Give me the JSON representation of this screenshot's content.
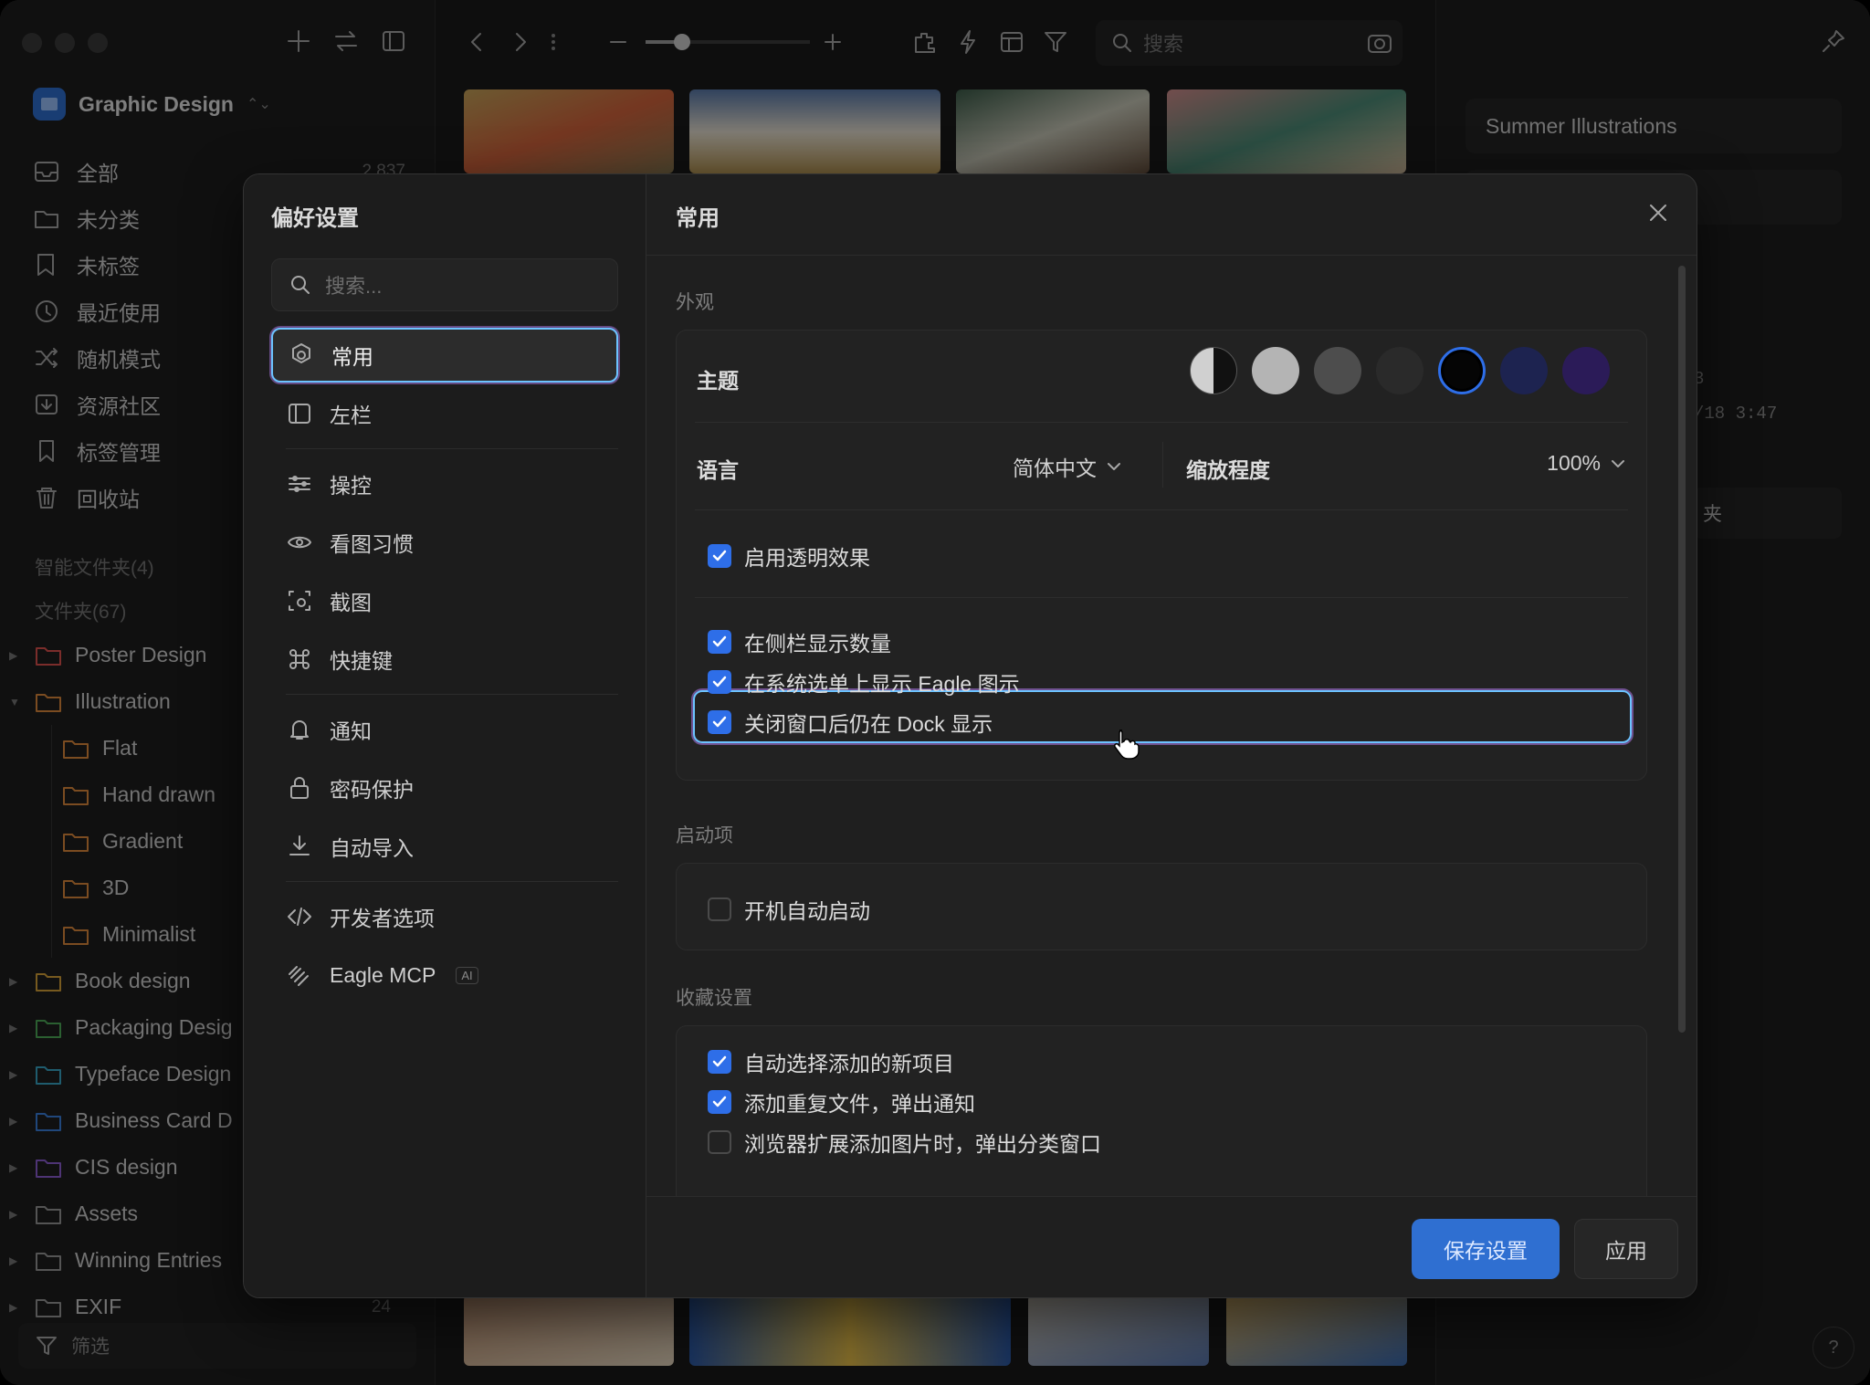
{
  "sidebar": {
    "library_name": "Graphic Design",
    "items": [
      {
        "label": "全部",
        "count": "2,837"
      },
      {
        "label": "未分类"
      },
      {
        "label": "未标签"
      },
      {
        "label": "最近使用"
      },
      {
        "label": "随机模式"
      },
      {
        "label": "资源社区"
      },
      {
        "label": "标签管理"
      },
      {
        "label": "回收站"
      }
    ],
    "smart_folders_label": "智能文件夹(4)",
    "folders_label": "文件夹(67)",
    "folders": [
      {
        "name": "Poster Design",
        "color": "#e0524f"
      },
      {
        "name": "Illustration",
        "color": "#e08a3c"
      },
      {
        "name": "Flat",
        "color": "#e08a3c"
      },
      {
        "name": "Hand drawn",
        "color": "#e08a3c"
      },
      {
        "name": "Gradient",
        "color": "#e08a3c"
      },
      {
        "name": "3D",
        "color": "#e08a3c"
      },
      {
        "name": "Minimalist",
        "color": "#e08a3c"
      },
      {
        "name": "Book design",
        "color": "#d9a43a"
      },
      {
        "name": "Packaging Desig",
        "color": "#4fae5a"
      },
      {
        "name": "Typeface Design",
        "color": "#3aa8c9"
      },
      {
        "name": "Business Card D",
        "color": "#3b82e0"
      },
      {
        "name": "CIS design",
        "color": "#8e5fd6"
      },
      {
        "name": "Assets",
        "color": "#9a9a9a"
      },
      {
        "name": "Winning Entries",
        "color": "#9a9a9a"
      },
      {
        "name": "EXIF",
        "color": "#9a9a9a",
        "count": "24"
      }
    ],
    "filter_label": "筛选"
  },
  "toolbar": {
    "search_placeholder": "搜索"
  },
  "inspector": {
    "title": "Summer Illustrations",
    "meta_fragment": "3",
    "date_fragment": "/18 3:47",
    "folder_fragment": "夹"
  },
  "prefs": {
    "title": "偏好设置",
    "search_placeholder": "搜索...",
    "nav": [
      {
        "label": "常用",
        "icon": "gear-icon"
      },
      {
        "label": "左栏",
        "icon": "sidebar-icon"
      },
      {
        "label": "操控",
        "icon": "sliders-icon"
      },
      {
        "label": "看图习惯",
        "icon": "eye-icon"
      },
      {
        "label": "截图",
        "icon": "screenshot-icon"
      },
      {
        "label": "快捷键",
        "icon": "command-icon"
      },
      {
        "label": "通知",
        "icon": "bell-icon"
      },
      {
        "label": "密码保护",
        "icon": "lock-icon"
      },
      {
        "label": "自动导入",
        "icon": "download-icon"
      },
      {
        "label": "开发者选项",
        "icon": "code-icon"
      },
      {
        "label": "Eagle MCP",
        "icon": "mcp-icon",
        "badge": "AI"
      }
    ],
    "panel": {
      "title": "常用",
      "appearance_label": "外观",
      "theme_label": "主题",
      "theme_colors": [
        "auto",
        "#b4b4b4",
        "#4d4d4d",
        "#2a2a2a",
        "#050505",
        "#1d2350",
        "#2b1b58"
      ],
      "language_label": "语言",
      "language_value": "简体中文",
      "zoom_label": "缩放程度",
      "zoom_value": "100%",
      "checks_appearance": [
        {
          "label": "启用透明效果",
          "checked": true
        },
        {
          "label": "在侧栏显示数量",
          "checked": true
        },
        {
          "label": "在系统选单上显示 Eagle 图示",
          "checked": true
        },
        {
          "label": "关闭窗口后仍在 Dock 显示",
          "checked": true
        }
      ],
      "startup_label": "启动项",
      "startup_check": {
        "label": "开机自动启动",
        "checked": false
      },
      "collect_label": "收藏设置",
      "collect_checks": [
        {
          "label": "自动选择添加的新项目",
          "checked": true
        },
        {
          "label": "添加重复文件，弹出通知",
          "checked": true
        },
        {
          "label": "浏览器扩展添加图片时，弹出分类窗口",
          "checked": false
        }
      ]
    },
    "save_label": "保存设置",
    "apply_label": "应用"
  },
  "colors": {
    "accent": "#2e6ee8",
    "highlight": "#6cc3ff"
  }
}
